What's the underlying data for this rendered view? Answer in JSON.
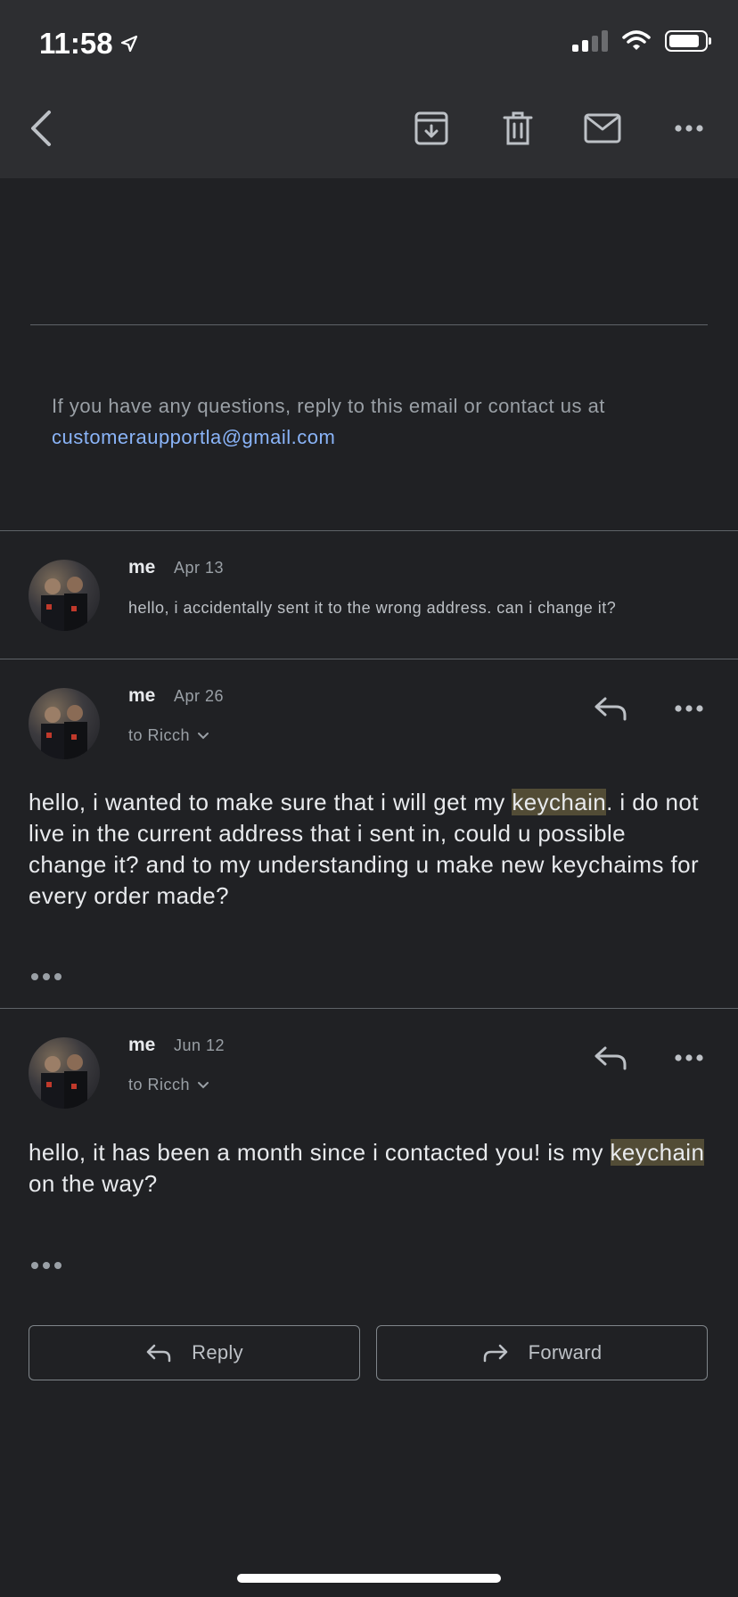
{
  "status_bar": {
    "time": "11:58"
  },
  "header": {
    "ghost_line_1": "",
    "ghost_line_2": ""
  },
  "footer_note": {
    "text": "If you have any questions, reply to this email or contact us at",
    "email": "customeraupportla@gmail.com"
  },
  "messages": [
    {
      "sender": "me",
      "date": "Apr 13",
      "snippet": "hello, i accidentally sent it to the wrong address. can i change it?"
    },
    {
      "sender": "me",
      "date": "Apr 26",
      "to": "to Ricch",
      "body_before": "hello, i wanted to make sure that i will get my ",
      "highlight": "keychain",
      "body_after": ". i do not live in the current address that i sent in, could u possible change it? and to my understanding u make new keychaims for every order made?"
    },
    {
      "sender": "me",
      "date": "Jun 12",
      "to": "to Ricch",
      "body_before": "hello, it has been a month since i contacted you! is my ",
      "highlight": "keychain",
      "body_after": " on the way?"
    }
  ],
  "actions": {
    "reply_label": "Reply",
    "forward_label": "Forward"
  },
  "icons": {
    "back": "chevron-left-icon",
    "archive": "archive-icon",
    "delete": "trash-icon",
    "mark_unread": "mail-icon",
    "more": "more-horizontal-icon",
    "reply": "reply-icon",
    "forward": "forward-icon"
  },
  "colors": {
    "background": "#202124",
    "toolbar": "#2d2e31",
    "link": "#8ab4f8",
    "highlight": "#524c36"
  }
}
